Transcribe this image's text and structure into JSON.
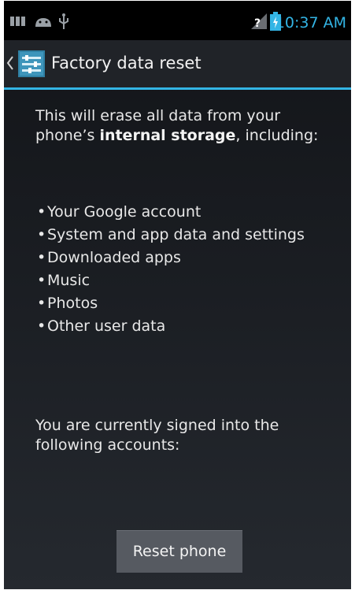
{
  "status_bar": {
    "time": "10:37 AM",
    "icons": [
      "notification-bars-icon",
      "android-icon",
      "usb-icon",
      "no-signal-icon",
      "battery-charging-icon"
    ],
    "accent_color": "#33b5e5"
  },
  "action_bar": {
    "title": "Factory data reset",
    "back_icon": "chevron-left-icon",
    "app_icon": "settings-app-icon"
  },
  "content": {
    "intro_before": "This will erase all data from your phone’s ",
    "intro_bold": "internal storage",
    "intro_after": ", including:",
    "items": [
      {
        "label": "Your Google account"
      },
      {
        "label": "System and app data and settings"
      },
      {
        "label": "Downloaded apps"
      },
      {
        "label": "Music"
      },
      {
        "label": "Photos"
      },
      {
        "label": "Other user data"
      }
    ],
    "bullet": "•",
    "signed_in_text": "You are currently signed into the following accounts:"
  },
  "actions": {
    "reset_label": "Reset phone"
  }
}
